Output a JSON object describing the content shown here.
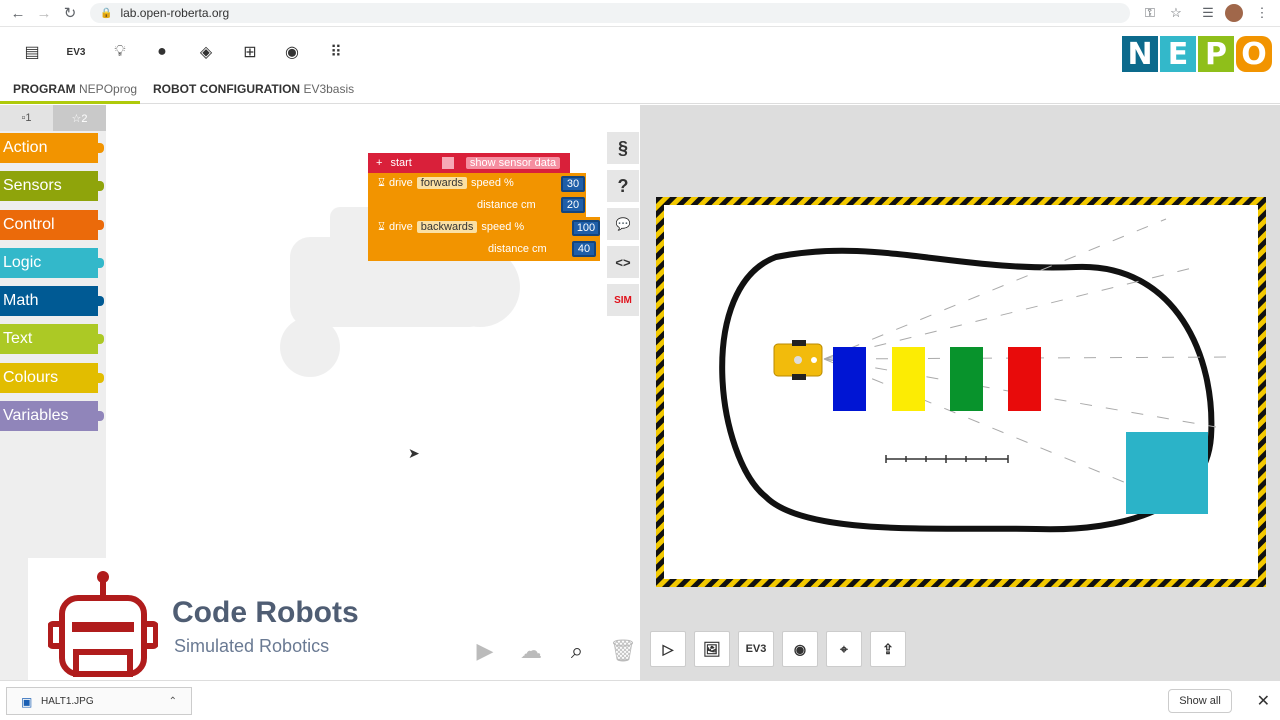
{
  "browser": {
    "url": "lab.open-roberta.org",
    "icons": [
      "back-icon",
      "forward-icon",
      "reload-icon",
      "lock-icon",
      "key-icon",
      "star-icon",
      "reading-list-icon",
      "avatar-icon",
      "menu-icon"
    ]
  },
  "toolbar": {
    "robot_label": "EV3",
    "icons": [
      "program-list-icon",
      "robot-ev3-icon",
      "help-lightbulb-icon",
      "user-icon",
      "education-icon",
      "gallery-icon",
      "language-globe-icon",
      "apps-grid-icon"
    ],
    "logo_text": "NEPO",
    "logo_colors": [
      "#0c6a8c",
      "#33b8ca",
      "#8fbf1a",
      "#f29400"
    ]
  },
  "tabs": {
    "program_label": "PROGRAM",
    "program_name": "NEPOprog",
    "config_label": "ROBOT CONFIGURATION",
    "config_name": "EV3basis",
    "active_color": "#afca0b"
  },
  "categories": {
    "tab1": "▫1",
    "tab2": "☆2",
    "items": [
      {
        "label": "Action",
        "color": "#f29400"
      },
      {
        "label": "Sensors",
        "color": "#8fa40b"
      },
      {
        "label": "Control",
        "color": "#eb6a0a"
      },
      {
        "label": "Logic",
        "color": "#33b8ca"
      },
      {
        "label": "Math",
        "color": "#005a94"
      },
      {
        "label": "Text",
        "color": "#acc925"
      },
      {
        "label": "Colours",
        "color": "#e2bd00"
      },
      {
        "label": "Variables",
        "color": "#9085ba"
      }
    ]
  },
  "program": {
    "start_label": "start",
    "show_sensor_label": "show sensor data",
    "drive_label": "drive",
    "dir1": "forwards",
    "dir2": "backwards",
    "speed_label": "speed %",
    "distance_label": "distance cm",
    "speed1": "30",
    "distance1": "20",
    "speed2": "100",
    "distance2": "40"
  },
  "side_buttons": [
    "§",
    "?",
    "💬",
    "<>",
    "SIM"
  ],
  "brand": {
    "title": "Code Robots",
    "subtitle": "Simulated Robotics",
    "logo_color": "#b01c1c"
  },
  "sim": {
    "controls": [
      "play-icon",
      "image-icon",
      "EV3",
      "sensor-icon",
      "marker-icon",
      "upload-icon"
    ],
    "ev3_label": "EV3",
    "blocks": [
      "#0015d4",
      "#fcec03",
      "#08932c",
      "#e80b0b"
    ],
    "cyan_block": "#2bb3c8"
  },
  "download": {
    "file_name": "HALT1.JPG",
    "show_all": "Show all"
  }
}
